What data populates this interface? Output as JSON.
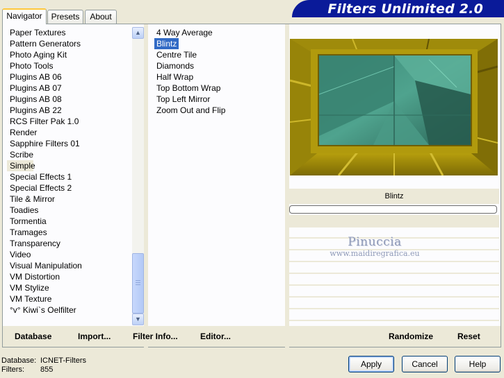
{
  "app": {
    "brand_title": "Filters Unlimited 2.0"
  },
  "tabs": [
    {
      "label": "Navigator",
      "active": true
    },
    {
      "label": "Presets",
      "active": false
    },
    {
      "label": "About",
      "active": false
    }
  ],
  "categories": {
    "selected": "Simple",
    "items": [
      "Paper Textures",
      "Pattern Generators",
      "Photo Aging Kit",
      "Photo Tools",
      "Plugins AB 06",
      "Plugins AB 07",
      "Plugins AB 08",
      "Plugins AB 22",
      "RCS Filter Pak 1.0",
      "Render",
      "Sapphire Filters 01",
      "Scribe",
      "Simple",
      "Special Effects 1",
      "Special Effects 2",
      "Tile & Mirror",
      "Toadies",
      "Tormentia",
      "Tramages",
      "Transparency",
      "Video",
      "Visual Manipulation",
      "VM Distortion",
      "VM Stylize",
      "VM Texture",
      "°v° Kiwi`s Oelfilter"
    ]
  },
  "filters": {
    "selected": "Blintz",
    "items": [
      "4 Way Average",
      "Blintz",
      "Centre Tile",
      "Diamonds",
      "Half Wrap",
      "Top Bottom Wrap",
      "Top Left Mirror",
      "Zoom Out and Flip"
    ]
  },
  "preview": {
    "filter_name": "Blintz",
    "colors": {
      "gold": "#b8a00e",
      "dark_gold": "#6b5a06",
      "teal": "#3f8f7a",
      "dark_teal": "#1f4a40"
    }
  },
  "watermark": {
    "name": "Pinuccia",
    "url": "www.maidiregrafica.eu"
  },
  "toolbar": {
    "database": "Database",
    "import": "Import...",
    "filter_info": "Filter Info...",
    "editor": "Editor...",
    "randomize": "Randomize",
    "reset": "Reset"
  },
  "status": {
    "database_label": "Database:",
    "database_value": "ICNET-Filters",
    "filters_label": "Filters:",
    "filters_value": "855"
  },
  "buttons": {
    "apply": "Apply",
    "cancel": "Cancel",
    "help": "Help"
  },
  "icons": {
    "scroll_up": "scroll-up-arrow-icon",
    "scroll_down": "scroll-down-arrow-icon"
  }
}
